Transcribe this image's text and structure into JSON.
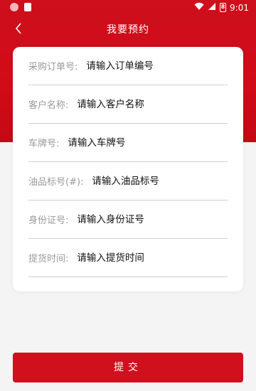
{
  "status_bar": {
    "time": "9:01",
    "battery_level": "8",
    "icons": [
      "notification-dot-icon",
      "sd-card-icon",
      "wifi-icon",
      "signal-icon",
      "battery-icon"
    ]
  },
  "header": {
    "title": "我要预约",
    "back_icon": "chevron-left-icon"
  },
  "form": {
    "fields": [
      {
        "label": "采购订单号:",
        "placeholder": "请输入订单编号",
        "value": ""
      },
      {
        "label": "客户名称:",
        "placeholder": "请输入客户名称",
        "value": ""
      },
      {
        "label": "车牌号:",
        "placeholder": "请输入车牌号",
        "value": ""
      },
      {
        "label": "油品标号(#):",
        "placeholder": "请输入油品标号",
        "value": ""
      },
      {
        "label": "身份证号:",
        "placeholder": "请输入身份证号",
        "value": ""
      },
      {
        "label": "提货时间:",
        "placeholder": "请输入提货时间",
        "value": ""
      }
    ]
  },
  "actions": {
    "submit_label": "提交"
  },
  "colors": {
    "brand_red": "#d0101d",
    "background": "#f4f4f4",
    "label_gray": "#9a9a9a",
    "divider": "#cfcfcf"
  }
}
